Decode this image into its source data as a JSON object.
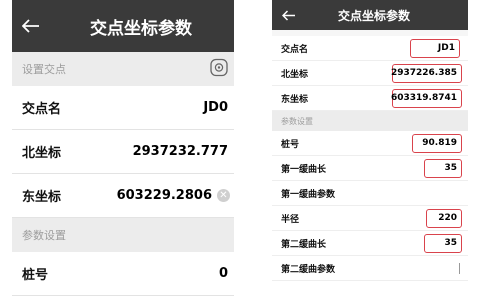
{
  "left": {
    "title": "交点坐标参数",
    "section_setting": "设置交点",
    "rows": [
      {
        "label": "交点名",
        "value": "JD0"
      },
      {
        "label": "北坐标",
        "value": "2937232.777"
      },
      {
        "label": "东坐标",
        "value": "603229.2806"
      }
    ],
    "section_params": "参数设置",
    "stake": {
      "label": "桩号",
      "value": "0"
    }
  },
  "right": {
    "title": "交点坐标参数",
    "rows_top": [
      {
        "label": "交点名",
        "value": "JD1"
      },
      {
        "label": "北坐标",
        "value": "2937226.385"
      },
      {
        "label": "东坐标",
        "value": "603319.8741"
      }
    ],
    "section_params": "参数设置",
    "rows_params": [
      {
        "label": "桩号",
        "value": "90.819"
      },
      {
        "label": "第一缓曲长",
        "value": "35"
      },
      {
        "label": "第一缓曲参数",
        "value": ""
      },
      {
        "label": "半径",
        "value": "220"
      },
      {
        "label": "第二缓曲长",
        "value": "35"
      },
      {
        "label": "第二缓曲参数",
        "value": ""
      }
    ]
  },
  "icons": {
    "back": "back-arrow-icon",
    "gps": "gps-locate-icon",
    "clear": "clear-icon"
  }
}
